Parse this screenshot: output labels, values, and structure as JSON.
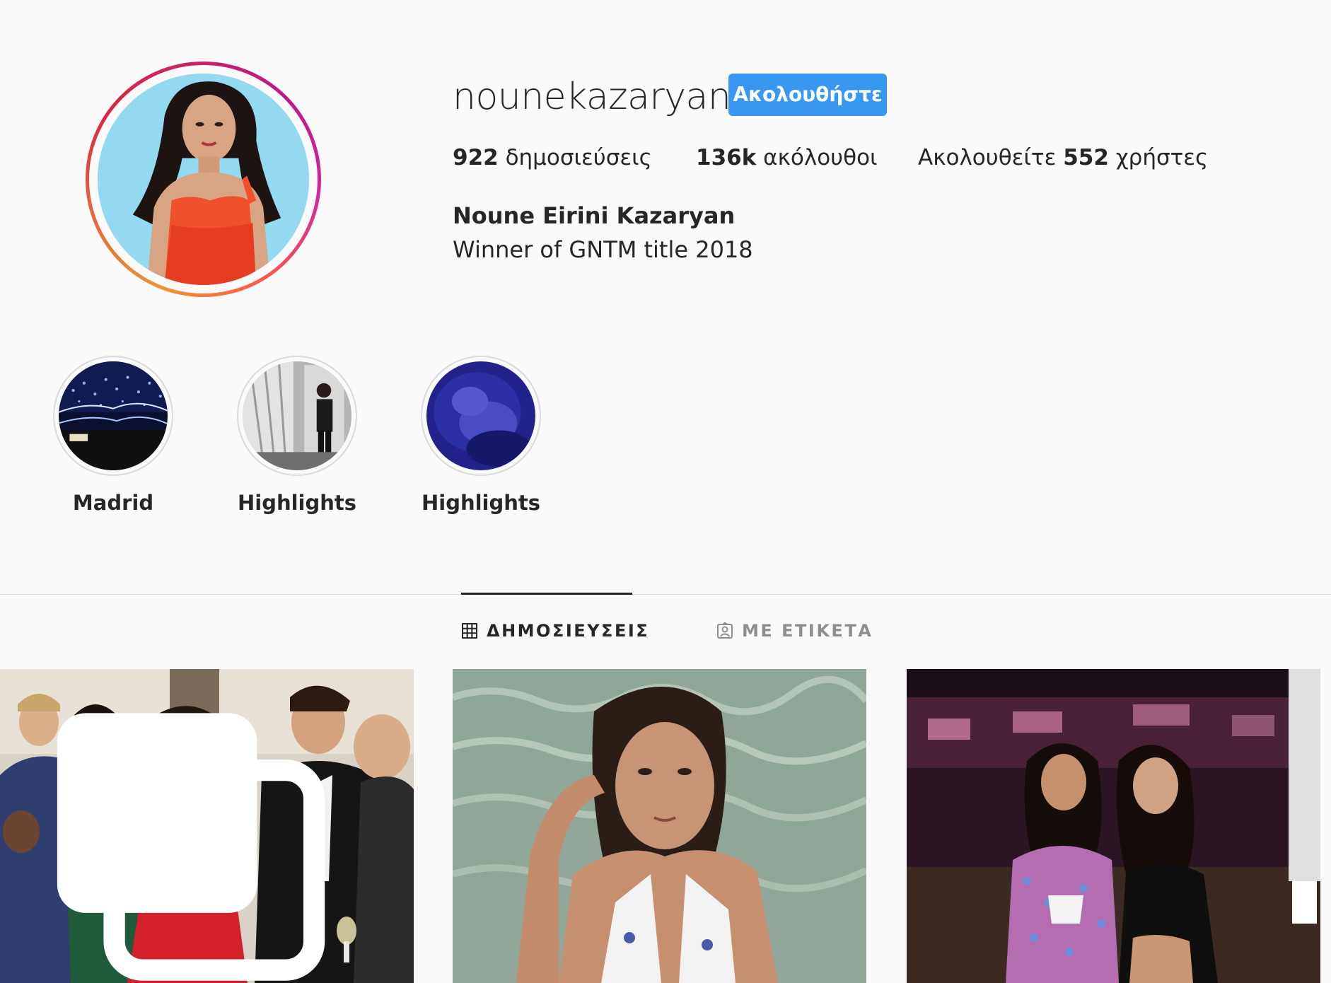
{
  "profile": {
    "username": "nounekazaryan",
    "follow_label": "Ακολουθήστε",
    "full_name": "Noune Eirini Kazaryan",
    "bio": "Winner of GNTM title 2018",
    "avatar_icon": "profile-photo"
  },
  "stats": {
    "posts_count": "922",
    "posts_label": " δημοσιεύσεις",
    "followers_count": "136k",
    "followers_label": " ακόλουθοι",
    "following_prefix": "Ακολουθείτε ",
    "following_count": "552",
    "following_suffix": " χρήστες"
  },
  "highlights": [
    {
      "label": "Madrid"
    },
    {
      "label": "Highlights"
    },
    {
      "label": "Highlights"
    }
  ],
  "tabs": [
    {
      "label": "ΔΗΜΟΣΙΕΥΣΕΙΣ",
      "icon": "grid-icon",
      "active": true
    },
    {
      "label": "ΜΕ ΕΤΙΚΕΤΑ",
      "icon": "tagged-icon",
      "active": false
    }
  ],
  "colors": {
    "accent": "#3897f0",
    "background": "#fafafa",
    "text": "#262626",
    "muted": "#8e8e8e",
    "divider": "#dbdbdb"
  }
}
